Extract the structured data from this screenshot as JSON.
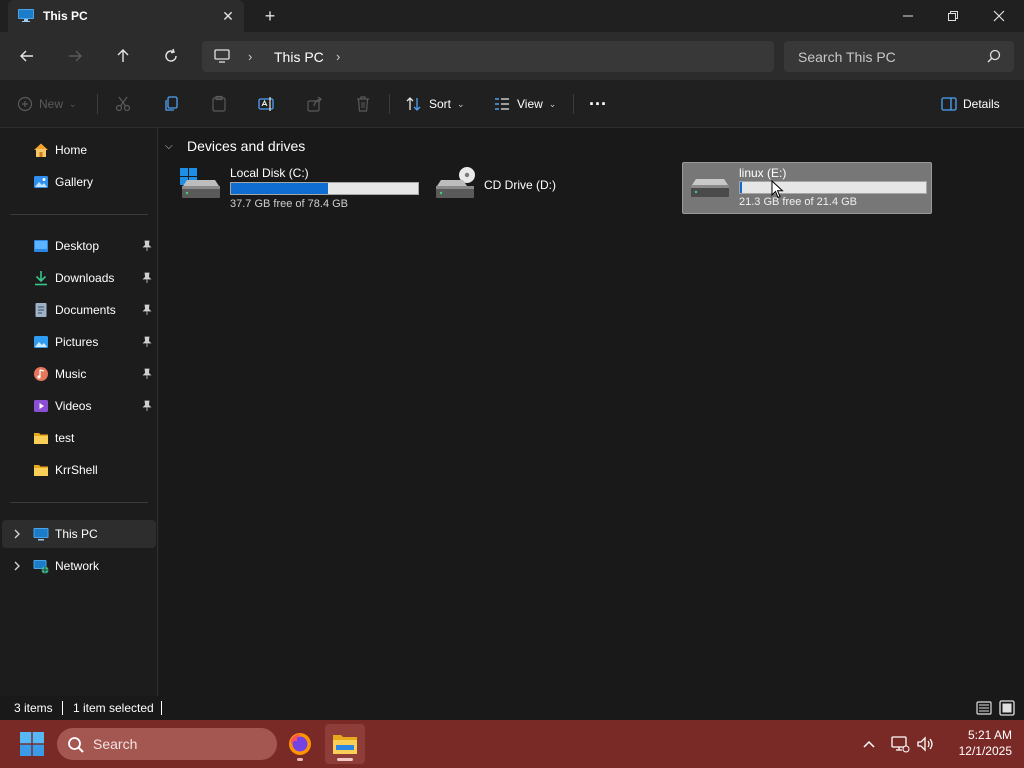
{
  "window": {
    "tab_title": "This PC",
    "new_tab_symbol": "+",
    "close_tab_symbol": "✕"
  },
  "address": {
    "crumb": "This PC",
    "search_placeholder": "Search This PC"
  },
  "commands": {
    "new": "New",
    "sort": "Sort",
    "view": "View",
    "more": "···",
    "details": "Details"
  },
  "sidebar": {
    "quick": [
      {
        "label": "Home",
        "icon": "home-icon"
      },
      {
        "label": "Gallery",
        "icon": "gallery-icon"
      }
    ],
    "pinned": [
      {
        "label": "Desktop",
        "icon": "desktop-folder-icon",
        "pinned": true
      },
      {
        "label": "Downloads",
        "icon": "downloads-folder-icon",
        "pinned": true
      },
      {
        "label": "Documents",
        "icon": "documents-folder-icon",
        "pinned": true
      },
      {
        "label": "Pictures",
        "icon": "pictures-folder-icon",
        "pinned": true
      },
      {
        "label": "Music",
        "icon": "music-folder-icon",
        "pinned": true
      },
      {
        "label": "Videos",
        "icon": "videos-folder-icon",
        "pinned": true
      },
      {
        "label": "test",
        "icon": "folder-icon",
        "pinned": false
      },
      {
        "label": "KrrShell",
        "icon": "folder-icon",
        "pinned": false
      }
    ],
    "locations": [
      {
        "label": "This PC",
        "icon": "this-pc-icon",
        "selected": true
      },
      {
        "label": "Network",
        "icon": "network-icon",
        "selected": false
      }
    ]
  },
  "content": {
    "group_title": "Devices and drives",
    "drives": [
      {
        "name": "Local Disk (C:)",
        "free": "37.7 GB free of 78.4 GB",
        "used_fraction": 0.52,
        "type": "system-disk",
        "selected": false
      },
      {
        "name": "CD Drive (D:)",
        "free": "",
        "used_fraction": null,
        "type": "cd-drive",
        "selected": false
      },
      {
        "name": "linux (E:)",
        "free": "21.3 GB free of 21.4 GB",
        "used_fraction": 0.01,
        "type": "disk",
        "selected": true
      }
    ]
  },
  "status": {
    "items": "3 items",
    "selected": "1 item selected"
  },
  "taskbar": {
    "search_placeholder": "Search",
    "time": "5:21 AM",
    "date": "12/1/2025"
  },
  "colors": {
    "accent": "#0f6cd1",
    "taskbar": "#7a2a26",
    "window_bg": "#1c1c1c"
  }
}
